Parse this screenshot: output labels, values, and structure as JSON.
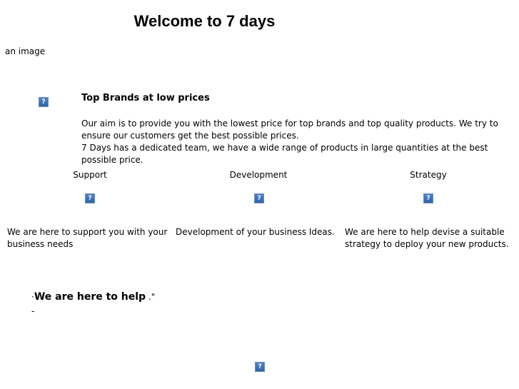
{
  "page": {
    "title": "Welcome to 7 days",
    "image_alt": "an image",
    "broken_image_glyph": "?"
  },
  "intro": {
    "heading": "Top Brands at low prices",
    "paragraph_1": "Our aim is to provide you with the lowest price for top brands and top quality products.  We try to ensure our customers get the best possible prices.",
    "paragraph_2": "7 Days has a dedicated team, we have a wide range of products in large quantities at the best possible price."
  },
  "columns": [
    {
      "heading": "Support",
      "text": "We are here to support you with your business needs"
    },
    {
      "heading": "Development",
      "text": "Development of your business Ideas."
    },
    {
      "heading": "Strategy",
      "text": "We are here to help devise a suitable strategy  to deploy your new products."
    }
  ],
  "quote": {
    "open_mark": "·",
    "text": "We are here to help",
    "close_mark": " .\"",
    "dash": "-"
  }
}
